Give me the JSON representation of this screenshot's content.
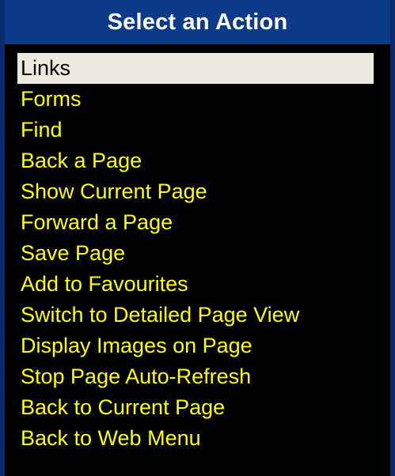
{
  "dialog": {
    "title": "Select an Action",
    "items": [
      {
        "label": "Links",
        "selected": true
      },
      {
        "label": "Forms"
      },
      {
        "label": "Find"
      },
      {
        "label": "Back a Page"
      },
      {
        "label": "Show Current Page"
      },
      {
        "label": "Forward a Page"
      },
      {
        "label": "Save Page"
      },
      {
        "label": "Add to Favourites"
      },
      {
        "label": "Switch to Detailed Page View"
      },
      {
        "label": "Display Images on Page"
      },
      {
        "label": "Stop Page Auto-Refresh"
      },
      {
        "label": "Back to Current Page"
      },
      {
        "label": "Back to Web Menu"
      }
    ]
  },
  "colors": {
    "title_bar": "#0d3b8a",
    "background": "#000000",
    "item_text": "#ffff00",
    "selected_bg": "#ece9df",
    "selected_text": "#000000"
  }
}
